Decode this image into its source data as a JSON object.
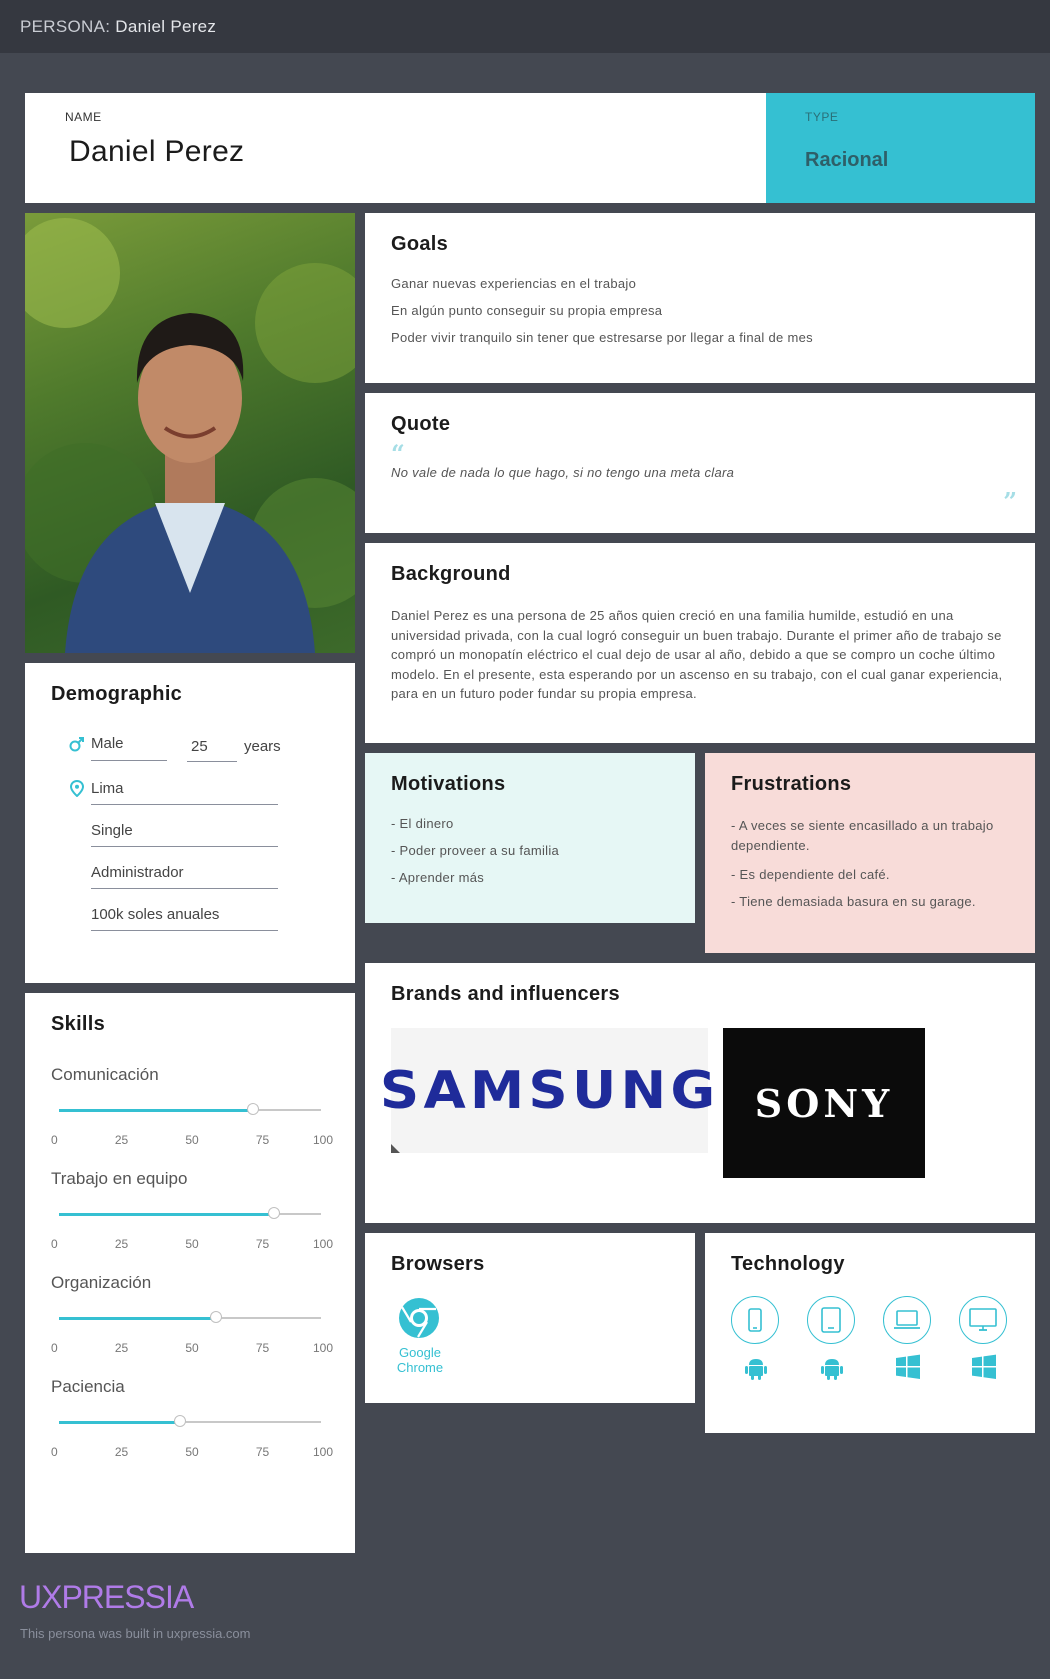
{
  "header": {
    "prefix": "PERSONA:",
    "name": "Daniel Perez"
  },
  "name_card": {
    "label": "NAME",
    "value": "Daniel Perez"
  },
  "type_card": {
    "label": "TYPE",
    "value": "Racional"
  },
  "goals": {
    "title": "Goals",
    "items": [
      "Ganar nuevas experiencias en el trabajo",
      "En algún punto conseguir su propia empresa",
      "Poder vivir tranquilo sin tener que estresarse por llegar a final de mes"
    ]
  },
  "quote": {
    "title": "Quote",
    "text": "No vale de nada lo que hago, si no tengo una meta clara"
  },
  "background": {
    "title": "Background",
    "text": "Daniel Perez es una persona de 25 años quien creció en una familia humilde, estudió en una universidad privada, con la cual logró conseguir un buen trabajo. Durante el primer año de trabajo se compró un monopatín eléctrico el cual dejo de usar al año, debido a que se compro un coche último modelo. En el presente, esta esperando por un ascenso en su trabajo, con el cual ganar experiencia, para en un futuro poder fundar su propia empresa."
  },
  "demographic": {
    "title": "Demographic",
    "gender": "Male",
    "age": "25",
    "age_unit": "years",
    "location": "Lima",
    "status": "Single",
    "occupation": "Administrador",
    "income": "100k soles anuales"
  },
  "motivations": {
    "title": "Motivations",
    "items": [
      "- El dinero",
      "- Poder proveer a su familia",
      "- Aprender más"
    ]
  },
  "frustrations": {
    "title": "Frustrations",
    "items": [
      "- A veces se siente encasillado a un trabajo dependiente.",
      "- Es dependiente del café.",
      "- Tiene demasiada basura en su garage."
    ]
  },
  "skills": {
    "title": "Skills",
    "scale": [
      "0",
      "25",
      "50",
      "75",
      "100"
    ],
    "items": [
      {
        "label": "Comunicación",
        "value": 74
      },
      {
        "label": "Trabajo en equipo",
        "value": 82
      },
      {
        "label": "Organización",
        "value": 60
      },
      {
        "label": "Paciencia",
        "value": 46
      }
    ]
  },
  "brands": {
    "title": "Brands and influencers",
    "items": [
      "SAMSUNG",
      "SONY"
    ]
  },
  "browsers": {
    "title": "Browsers",
    "items": [
      {
        "name": "Google Chrome",
        "icon": "chrome-icon"
      }
    ]
  },
  "technology": {
    "title": "Technology",
    "devices": [
      {
        "device": "phone-icon",
        "os": "android-icon"
      },
      {
        "device": "tablet-icon",
        "os": "android-icon"
      },
      {
        "device": "laptop-icon",
        "os": "windows-icon"
      },
      {
        "device": "desktop-icon",
        "os": "windows-icon"
      }
    ]
  },
  "footer": {
    "brand": "UXPRESSIA",
    "note": "This persona was built in uxpressia.com"
  },
  "colors": {
    "accent": "#35c0d2",
    "motivations_bg": "#e6f7f5",
    "frustrations_bg": "#f8dcd9",
    "footer_brand": "#b07be8",
    "page_bg": "#444851"
  }
}
